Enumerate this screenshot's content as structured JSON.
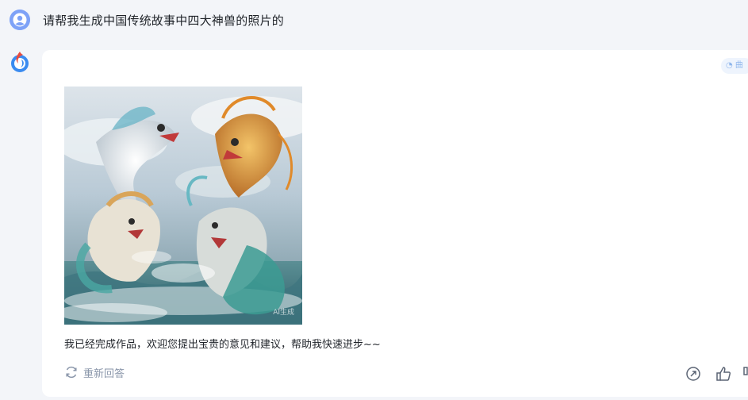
{
  "user": {
    "message": "请帮我生成中国传统故事中四大神兽的照片的"
  },
  "bot": {
    "model_badge": "曲",
    "image": {
      "watermark": "AI生成"
    },
    "reply": "我已经完成作品，欢迎您提出宝贵的意见和建议，帮助我快速进步~~",
    "actions": {
      "regenerate_label": "重新回答"
    }
  },
  "colors": {
    "background": "#f3f5f9",
    "card": "#ffffff",
    "muted": "#8a96aa",
    "accent": "#4f7ef0"
  },
  "icons": [
    "user-avatar-icon",
    "bot-logo-icon",
    "refresh-icon",
    "share-icon",
    "thumbs-up-icon",
    "thumbs-down-icon"
  ]
}
